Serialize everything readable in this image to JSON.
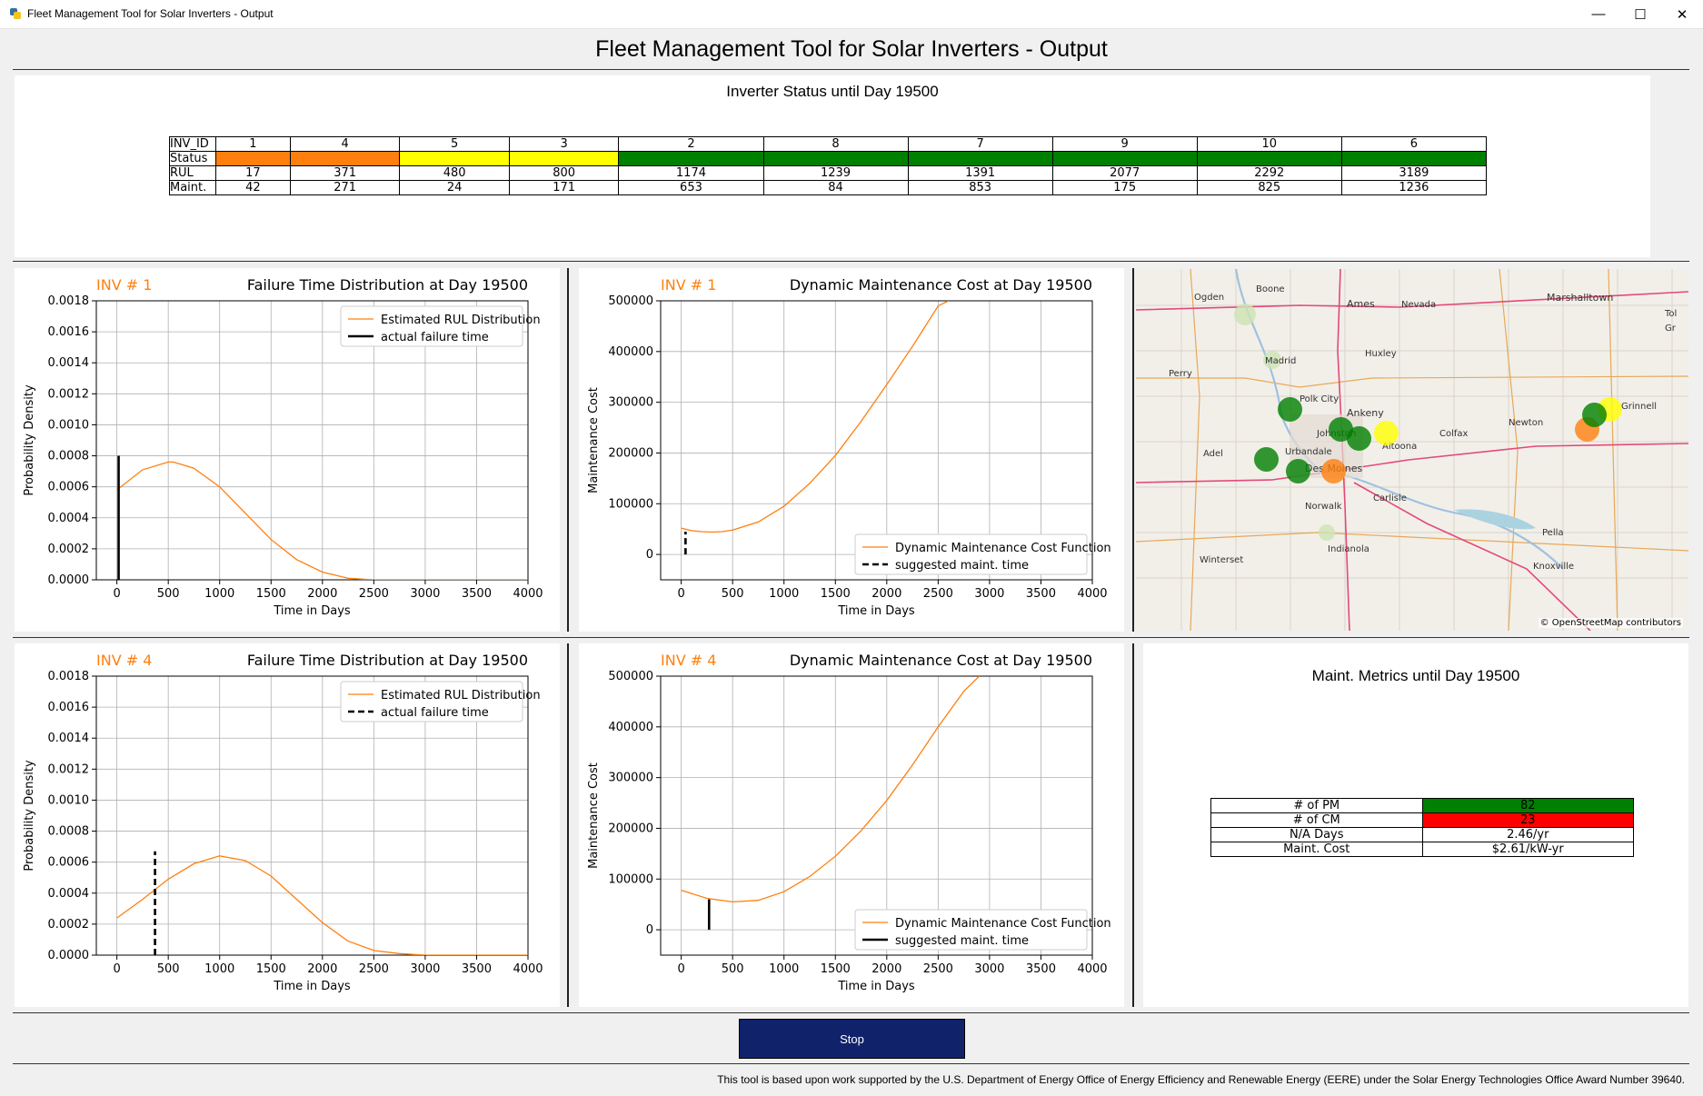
{
  "window": {
    "title": "Fleet Management Tool for Solar Inverters - Output",
    "minimize": "—",
    "maximize": "☐",
    "close": "✕"
  },
  "header": {
    "title": "Fleet Management Tool for Solar Inverters - Output"
  },
  "status_table": {
    "title": "Inverter Status until Day 19500",
    "row_labels": [
      "INV_ID",
      "Status",
      "RUL",
      "Maint."
    ],
    "columns": [
      {
        "id": "1",
        "status_color": "#ff7f0e",
        "rul": "17",
        "maint": "42"
      },
      {
        "id": "4",
        "status_color": "#ff7f0e",
        "rul": "371",
        "maint": "271"
      },
      {
        "id": "5",
        "status_color": "#ffff00",
        "rul": "480",
        "maint": "24"
      },
      {
        "id": "3",
        "status_color": "#ffff00",
        "rul": "800",
        "maint": "171"
      },
      {
        "id": "2",
        "status_color": "#008000",
        "rul": "1174",
        "maint": "653"
      },
      {
        "id": "8",
        "status_color": "#008000",
        "rul": "1239",
        "maint": "84"
      },
      {
        "id": "7",
        "status_color": "#008000",
        "rul": "1391",
        "maint": "853"
      },
      {
        "id": "9",
        "status_color": "#008000",
        "rul": "2077",
        "maint": "175"
      },
      {
        "id": "10",
        "status_color": "#008000",
        "rul": "2292",
        "maint": "825"
      },
      {
        "id": "6",
        "status_color": "#008000",
        "rul": "3189",
        "maint": "1236"
      }
    ]
  },
  "plots": [
    {
      "inv_label": "INV # 1",
      "title": "Failure Time Distribution at Day 19500"
    },
    {
      "inv_label": "INV # 1",
      "title": "Dynamic Maintenance Cost at Day 19500"
    },
    {
      "inv_label": "INV # 4",
      "title": "Failure Time Distribution at Day 19500"
    },
    {
      "inv_label": "INV # 4",
      "title": "Dynamic Maintenance Cost at Day 19500"
    }
  ],
  "chart_data": [
    {
      "type": "line",
      "title": "Failure Time Distribution at Day 19500",
      "xlabel": "Time in Days",
      "ylabel": "Probability Density",
      "xlim": [
        -200,
        4000
      ],
      "ylim": [
        0,
        0.0018
      ],
      "xticks": [
        0,
        500,
        1000,
        1500,
        2000,
        2500,
        3000,
        3500,
        4000
      ],
      "yticks": [
        "0.0000",
        "0.0002",
        "0.0004",
        "0.0006",
        "0.0008",
        "0.0010",
        "0.0012",
        "0.0014",
        "0.0016",
        "0.0018"
      ],
      "grid": true,
      "legend_position": "upper right",
      "series": [
        {
          "name": "Estimated RUL Distribution",
          "color": "#ff7f0e",
          "x": [
            0,
            250,
            500,
            550,
            750,
            1000,
            1250,
            1500,
            1750,
            2000,
            2250,
            2500,
            2750,
            3000,
            3500,
            4000
          ],
          "values": [
            0.00058,
            0.00071,
            0.00076,
            0.00076,
            0.00072,
            0.0006,
            0.00043,
            0.00026,
            0.00013,
            5e-05,
            1e-05,
            0.0,
            0.0,
            0.0,
            0.0,
            0.0
          ]
        },
        {
          "name": "actual failure time",
          "color": "#000000",
          "style": "solid",
          "x": 17,
          "y_range": [
            0,
            0.0008
          ]
        }
      ]
    },
    {
      "type": "line",
      "title": "Dynamic Maintenance Cost at Day 19500",
      "xlabel": "Time in Days",
      "ylabel": "Maintenance Cost",
      "xlim": [
        -200,
        4000
      ],
      "ylim": [
        -50000,
        500000
      ],
      "xticks": [
        0,
        500,
        1000,
        1500,
        2000,
        2500,
        3000,
        3500,
        4000
      ],
      "yticks": [
        0,
        100000,
        200000,
        300000,
        400000,
        500000
      ],
      "grid": true,
      "legend_position": "lower right",
      "series": [
        {
          "name": "Dynamic Maintenance Cost Function",
          "color": "#ff7f0e",
          "x": [
            0,
            100,
            200,
            300,
            400,
            500,
            750,
            1000,
            1250,
            1500,
            1750,
            2000,
            2250,
            2500,
            2600
          ],
          "values": [
            52000,
            47000,
            45000,
            44000,
            45000,
            48000,
            64000,
            95000,
            140000,
            195000,
            262000,
            335000,
            410000,
            490000,
            500000
          ]
        },
        {
          "name": "suggested maint. time",
          "color": "#000000",
          "style": "dashed",
          "x": 42,
          "y_range": [
            0,
            45000
          ]
        }
      ]
    },
    {
      "type": "line",
      "title": "Failure Time Distribution at Day 19500",
      "xlabel": "Time in Days",
      "ylabel": "Probability Density",
      "xlim": [
        -200,
        4000
      ],
      "ylim": [
        0,
        0.0018
      ],
      "xticks": [
        0,
        500,
        1000,
        1500,
        2000,
        2500,
        3000,
        3500,
        4000
      ],
      "yticks": [
        "0.0000",
        "0.0002",
        "0.0004",
        "0.0006",
        "0.0008",
        "0.0010",
        "0.0012",
        "0.0014",
        "0.0016",
        "0.0018"
      ],
      "grid": true,
      "legend_position": "upper right",
      "series": [
        {
          "name": "Estimated RUL Distribution",
          "color": "#ff7f0e",
          "x": [
            0,
            250,
            500,
            750,
            1000,
            1250,
            1500,
            1750,
            2000,
            2250,
            2500,
            2750,
            3000,
            3500,
            4000
          ],
          "values": [
            0.00024,
            0.00036,
            0.00049,
            0.00059,
            0.00064,
            0.00061,
            0.00051,
            0.00036,
            0.00021,
            9e-05,
            3e-05,
            1e-05,
            0.0,
            0.0,
            0.0
          ]
        },
        {
          "name": "actual failure time",
          "color": "#000000",
          "style": "dashed",
          "x": 371,
          "y_range": [
            0,
            0.00067
          ]
        }
      ]
    },
    {
      "type": "line",
      "title": "Dynamic Maintenance Cost at Day 19500",
      "xlabel": "Time in Days",
      "ylabel": "Maintenance Cost",
      "xlim": [
        -200,
        4000
      ],
      "ylim": [
        -50000,
        500000
      ],
      "xticks": [
        0,
        500,
        1000,
        1500,
        2000,
        2500,
        3000,
        3500,
        4000
      ],
      "yticks": [
        0,
        100000,
        200000,
        300000,
        400000,
        500000
      ],
      "grid": true,
      "legend_position": "lower right",
      "series": [
        {
          "name": "Dynamic Maintenance Cost Function",
          "color": "#ff7f0e",
          "x": [
            0,
            250,
            500,
            750,
            1000,
            1250,
            1500,
            1750,
            2000,
            2250,
            2500,
            2750,
            2900
          ],
          "values": [
            78000,
            62000,
            55000,
            58000,
            75000,
            105000,
            145000,
            195000,
            255000,
            325000,
            400000,
            470000,
            500000
          ]
        },
        {
          "name": "suggested maint. time",
          "color": "#000000",
          "style": "solid",
          "x": 271,
          "y_range": [
            0,
            60000
          ]
        }
      ]
    }
  ],
  "map": {
    "attribution": "© OpenStreetMap contributors",
    "labels": [
      "Boone",
      "Ogden",
      "Ames",
      "Nevada",
      "Marshalltown",
      "Huxley",
      "Madrid",
      "Perry",
      "Polk City",
      "Ankeny",
      "Johnston",
      "Newton",
      "Colfax",
      "Altoona",
      "Adel",
      "Urbandale",
      "Des Moines",
      "Carlisle",
      "Norwalk",
      "Pella",
      "Indianola",
      "Winterset",
      "Knoxville",
      "Tol",
      "Gr",
      "Grinnell"
    ],
    "markers": [
      {
        "color": "#008000"
      },
      {
        "color": "#008000"
      },
      {
        "color": "#008000"
      },
      {
        "color": "#008000"
      },
      {
        "color": "#008000"
      },
      {
        "color": "#ff7f0e"
      },
      {
        "color": "#ffff00"
      },
      {
        "color": "#ffff00"
      },
      {
        "color": "#ff7f0e"
      },
      {
        "color": "#008000"
      }
    ]
  },
  "metrics": {
    "title": "Maint. Metrics until Day 19500",
    "rows": [
      {
        "label": "# of PM",
        "value": "82",
        "color": "#008000"
      },
      {
        "label": "# of CM",
        "value": "23",
        "color": "#ff0000"
      },
      {
        "label": "N/A Days",
        "value": "2.46/yr",
        "color": "#ffffff"
      },
      {
        "label": "Maint. Cost",
        "value": "$2.61/kW-yr",
        "color": "#ffffff"
      }
    ]
  },
  "stop_button": {
    "label": "Stop"
  },
  "footer": {
    "text": "This tool is based upon work supported by the U.S. Department of Energy Office of Energy Efficiency and Renewable Energy (EERE) under the Solar Energy Technologies Office Award Number 39640."
  }
}
